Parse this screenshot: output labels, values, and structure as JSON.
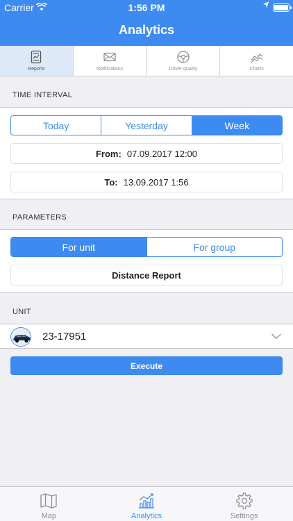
{
  "status_bar": {
    "carrier": "Carrier",
    "time": "1:56 PM"
  },
  "header": {
    "title": "Analytics"
  },
  "top_tabs": [
    {
      "label": "Reports",
      "icon": "reports-icon"
    },
    {
      "label": "Notifications",
      "icon": "envelope-icon"
    },
    {
      "label": "Driver quality",
      "icon": "steering-wheel-icon"
    },
    {
      "label": "Charts",
      "icon": "chart-line-icon"
    }
  ],
  "time_interval": {
    "section_title": "TIME INTERVAL",
    "segments": [
      "Today",
      "Yesterday",
      "Week"
    ],
    "selected": "Week",
    "from_label": "From:",
    "from_value": "07.09.2017 12:00",
    "to_label": "To:",
    "to_value": "13.09.2017 1:56"
  },
  "parameters": {
    "section_title": "PARAMETERS",
    "segments": [
      "For unit",
      "For group"
    ],
    "selected": "For unit",
    "report_name": "Distance Report"
  },
  "unit": {
    "section_title": "UNIT",
    "name": "23-17951"
  },
  "execute_label": "Execute",
  "bottom_tabs": [
    {
      "label": "Map",
      "icon": "map-icon"
    },
    {
      "label": "Analytics",
      "icon": "analytics-chart-icon"
    },
    {
      "label": "Settings",
      "icon": "gear-icon"
    }
  ],
  "colors": {
    "accent": "#3d8bf0",
    "background": "#efeff4"
  }
}
